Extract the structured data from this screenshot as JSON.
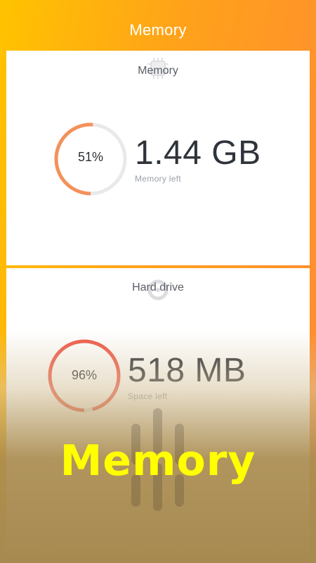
{
  "header": {
    "title": "Memory"
  },
  "memory_card": {
    "label": "Memory",
    "percent_text": "51%",
    "percent": 51,
    "value": "1.44 GB",
    "sublabel": "Memory left",
    "ring_color": "#f4915a",
    "icon": "chip-icon"
  },
  "disk_card": {
    "label": "Hard drive",
    "percent_text": "96%",
    "percent": 96,
    "value": "518 MB",
    "sublabel": "Space left",
    "ring_color": "#f05a4a",
    "icon": "disk-icon"
  },
  "promo": {
    "text": "Memory"
  },
  "colors": {
    "accent_start": "#ffc300",
    "accent_end": "#ff8a33",
    "ring_track": "#e9e9ec"
  }
}
